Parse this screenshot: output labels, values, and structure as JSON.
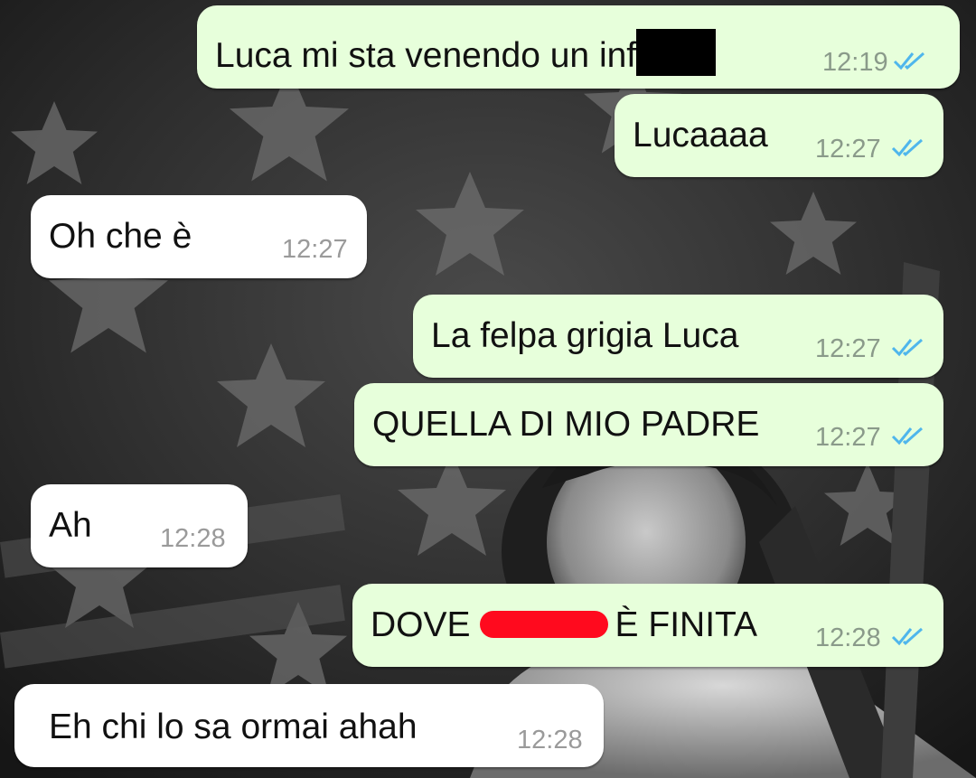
{
  "messages": [
    {
      "id": "m1",
      "dir": "out",
      "text": "Luca mi sta venendo un inf",
      "redacted": "black",
      "time": "12:19",
      "status": "read"
    },
    {
      "id": "m2",
      "dir": "out",
      "text": "Lucaaaa",
      "time": "12:27",
      "status": "read"
    },
    {
      "id": "m3",
      "dir": "in",
      "text": "Oh che è",
      "time": "12:27"
    },
    {
      "id": "m4",
      "dir": "out",
      "text": "La felpa grigia Luca",
      "time": "12:27",
      "status": "read"
    },
    {
      "id": "m5",
      "dir": "out",
      "text": "QUELLA DI MIO PADRE",
      "time": "12:27",
      "status": "read"
    },
    {
      "id": "m6",
      "dir": "in",
      "text": "Ah",
      "time": "12:28"
    },
    {
      "id": "m7",
      "dir": "out",
      "text_before": "DOVE",
      "text_after": "È FINITA",
      "redacted": "red",
      "time": "12:28",
      "status": "read"
    },
    {
      "id": "m8",
      "dir": "in",
      "text": "Eh chi lo sa ormai ahah",
      "time": "12:28"
    }
  ],
  "colors": {
    "outgoing_bubble": "#e7ffdb",
    "incoming_bubble": "#ffffff",
    "read_ticks": "#4fb6ec",
    "redaction_red": "#ff0a1e"
  },
  "icons": {
    "read_receipt": "double-check-icon"
  }
}
